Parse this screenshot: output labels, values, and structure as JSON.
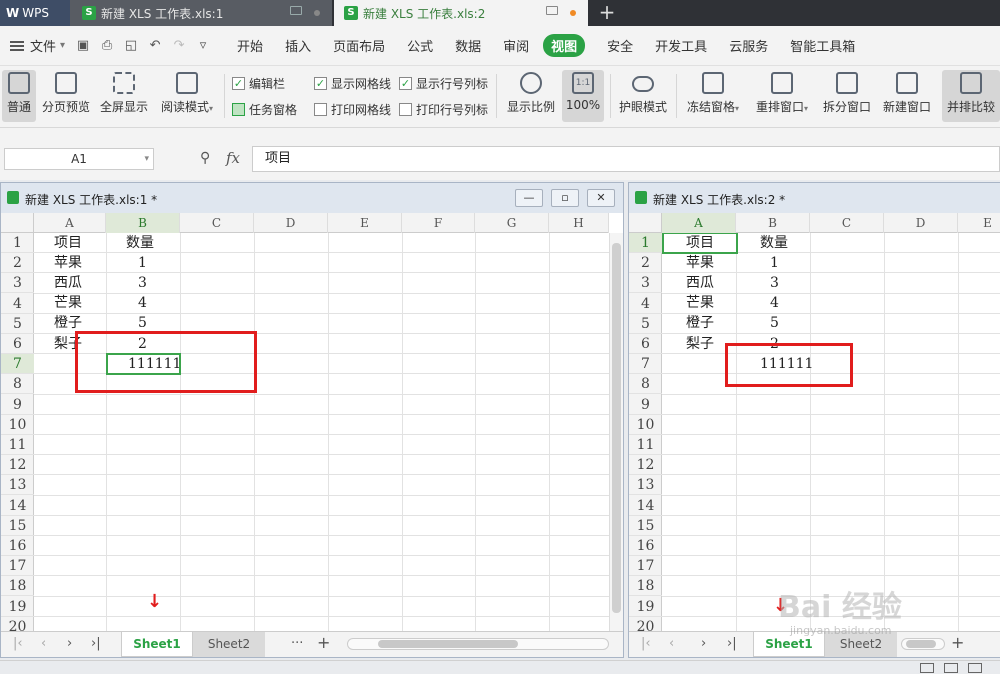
{
  "titlebar": {
    "wps_label": "WPS",
    "tabs": [
      {
        "label": "新建 XLS 工作表.xls:1"
      },
      {
        "label": "新建 XLS 工作表.xls:2"
      }
    ],
    "new_tab": "+"
  },
  "menubar": {
    "file": "文件",
    "items": [
      "开始",
      "插入",
      "页面布局",
      "公式",
      "数据",
      "审阅",
      "视图",
      "安全",
      "开发工具",
      "云服务",
      "智能工具箱"
    ],
    "active_item": "视图"
  },
  "ribbon": {
    "normal": "普通",
    "page_preview": "分页预览",
    "fullscreen": "全屏显示",
    "reading_mode": "阅读模式",
    "edit_bar": "编辑栏",
    "task_pane": "任务窗格",
    "show_gridlines": "显示网格线",
    "print_gridlines": "打印网格线",
    "show_headers": "显示行号列标",
    "print_headers": "打印行号列标",
    "zoom_ratio": "显示比例",
    "zoom_100": "100%",
    "zoom_100_icon": "1:1",
    "eye_mode": "护眼模式",
    "freeze": "冻结窗格",
    "arrange": "重排窗口",
    "split": "拆分窗口",
    "new_window": "新建窗口",
    "side_by_side": "并排比较"
  },
  "formula": {
    "name_box": "A1",
    "fx": "fx",
    "content": "项目"
  },
  "window_left": {
    "title": "新建 XLS 工作表.xls:1 *",
    "columns": [
      "A",
      "B",
      "C",
      "D",
      "E",
      "F",
      "G",
      "H"
    ],
    "rows": [
      "1",
      "2",
      "3",
      "4",
      "5",
      "6",
      "7",
      "8",
      "9",
      "10",
      "11",
      "12",
      "13",
      "14",
      "15",
      "16",
      "17",
      "18",
      "19",
      "20"
    ],
    "sheets": [
      "Sheet1",
      "Sheet2"
    ],
    "more": "···",
    "add": "+"
  },
  "window_right": {
    "title": "新建 XLS 工作表.xls:2 *",
    "columns": [
      "A",
      "B",
      "C",
      "D",
      "E"
    ],
    "rows": [
      "1",
      "2",
      "3",
      "4",
      "5",
      "6",
      "7",
      "8",
      "9",
      "10",
      "11",
      "12",
      "13",
      "14",
      "15",
      "16",
      "17",
      "18",
      "19",
      "20"
    ],
    "sheets": [
      "Sheet1",
      "Sheet2"
    ],
    "add": "+"
  },
  "cells": {
    "a1": "项目",
    "b1": "数量",
    "a2": "苹果",
    "b2": "1",
    "a3": "西瓜",
    "b3": "3",
    "a4": "芒果",
    "b4": "4",
    "a5": "橙子",
    "b5": "5",
    "a6": "梨子",
    "b6": "2",
    "b7": "111111"
  },
  "watermark": {
    "main": "Bai 经验",
    "sub": "jingyan.baidu.com"
  },
  "colors": {
    "accent": "#2ba245",
    "annotation": "#e11d1d"
  }
}
